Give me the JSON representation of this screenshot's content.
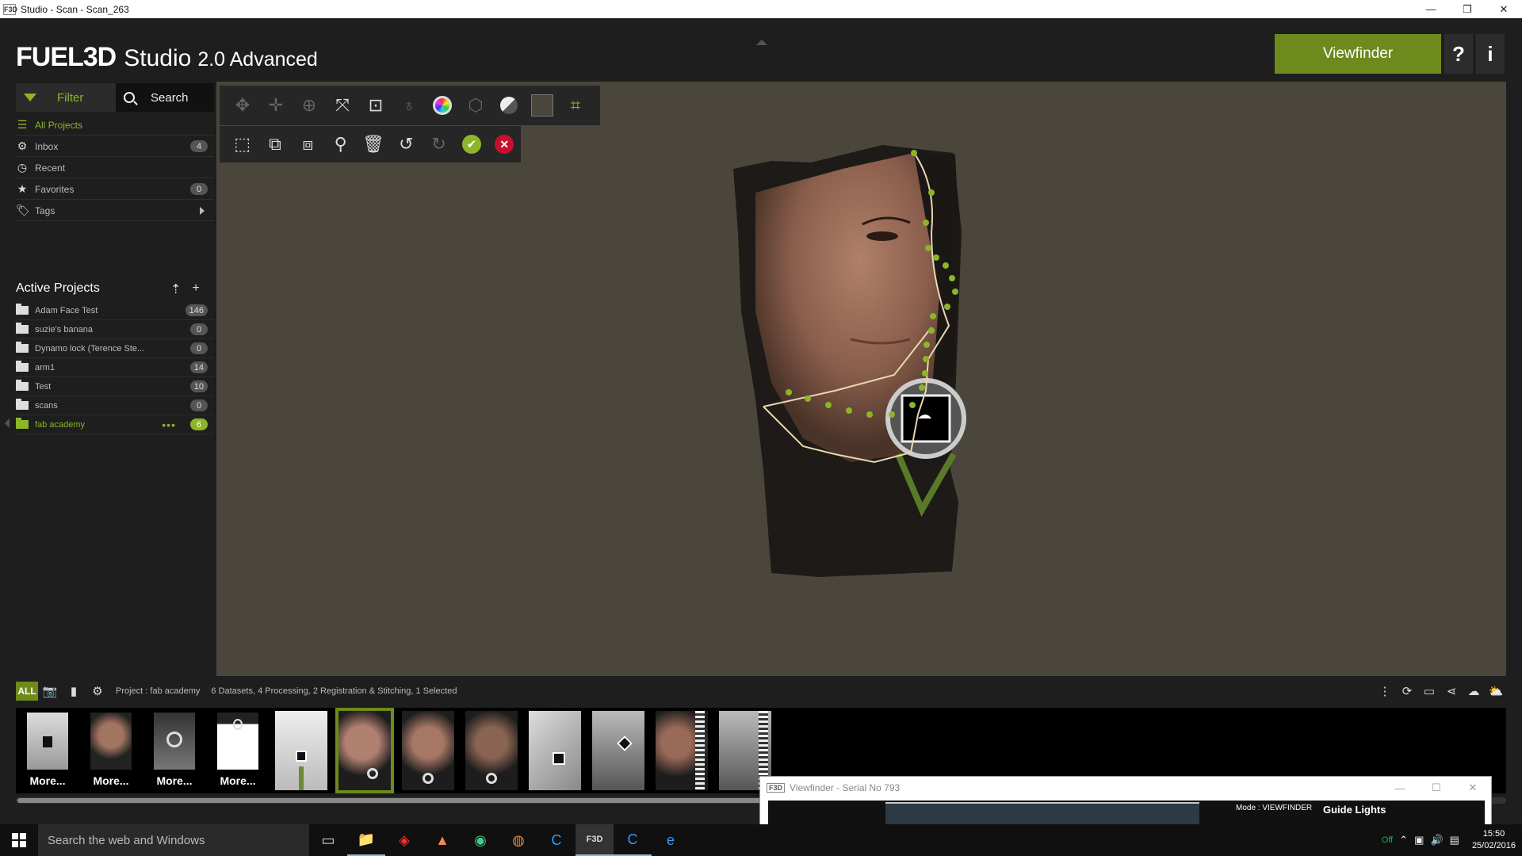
{
  "window": {
    "title": "Studio - Scan - Scan_263",
    "icon": "F3D",
    "controls": [
      "—",
      "❐",
      "✕"
    ]
  },
  "header": {
    "logo": "FUEL3D",
    "product": "Studio",
    "version": "2.0 Advanced",
    "viewfinder_label": "Viewfinder",
    "help_label": "?",
    "info_label": "i"
  },
  "sidebar": {
    "filter_label": "Filter",
    "search_label": "Search",
    "items": [
      {
        "label": "All Projects",
        "icon": "stack-icon",
        "count": ""
      },
      {
        "label": "Inbox",
        "icon": "gear-icon",
        "count": "4"
      },
      {
        "label": "Recent",
        "icon": "clock-icon",
        "count": ""
      },
      {
        "label": "Favorites",
        "icon": "star-icon",
        "count": "0"
      },
      {
        "label": "Tags",
        "icon": "tag-icon",
        "count": ""
      }
    ],
    "active_projects_title": "Active Projects",
    "projects": [
      {
        "label": "Adam Face Test",
        "count": "146"
      },
      {
        "label": "suzie's banana",
        "count": "0"
      },
      {
        "label": "Dynamo lock (Terence Ste...",
        "count": "0"
      },
      {
        "label": "arm1",
        "count": "14"
      },
      {
        "label": "Test",
        "count": "10"
      },
      {
        "label": "scans",
        "count": "0"
      },
      {
        "label": "fab academy",
        "count": "6",
        "dots": "•••"
      }
    ]
  },
  "toolbar": {
    "row1": [
      "orbit-icon",
      "pan-icon",
      "zoom-icon",
      "fit-view-icon",
      "focus-icon",
      "light-icon",
      "color-texture-icon",
      "cube-icon",
      "contrast-icon",
      "background-swatch-icon",
      "crop-icon"
    ],
    "row2": [
      "select-region-icon",
      "select-add-icon",
      "select-subtract-icon",
      "lasso-icon",
      "delete-icon",
      "undo-icon",
      "redo-icon",
      "confirm-icon",
      "cancel-icon"
    ]
  },
  "bottom": {
    "all_label": "ALL",
    "project": "Project : fab academy",
    "stats": [
      "6 Datasets,",
      "4 Processing,",
      "2 Registration & Stitching,",
      "1 Selected"
    ],
    "thumbnails": [
      {
        "label": "More..."
      },
      {
        "label": "More..."
      },
      {
        "label": "More..."
      },
      {
        "label": "More..."
      },
      {
        "label": ""
      },
      {
        "label": ""
      },
      {
        "label": ""
      },
      {
        "label": ""
      },
      {
        "label": ""
      },
      {
        "label": ""
      },
      {
        "label": ""
      },
      {
        "label": ""
      }
    ]
  },
  "viewfinder_window": {
    "title": "Viewfinder - Serial No 793",
    "mode": "Mode : VIEWFINDER",
    "guide": "Guide Lights"
  },
  "taskbar": {
    "search_placeholder": "Search the web and Windows",
    "time": "15:50",
    "date": "25/02/2016",
    "tray_badge": "Off"
  },
  "colors": {
    "accent": "#6e8a1c",
    "accent_light": "#8cb528",
    "viewport": "#4b463b",
    "panel": "#1e1e1e"
  }
}
